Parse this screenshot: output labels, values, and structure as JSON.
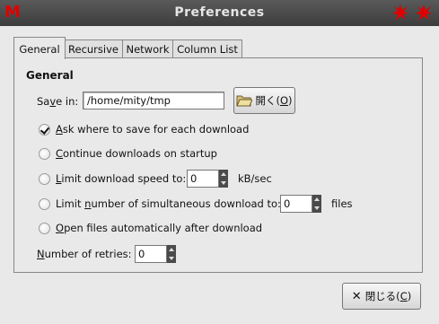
{
  "window": {
    "title": "Preferences"
  },
  "tabs": [
    {
      "label": "General"
    },
    {
      "label": "Recursive"
    },
    {
      "label": "Network"
    },
    {
      "label": "Column List"
    }
  ],
  "general": {
    "section_title": "General",
    "save_in": {
      "label_pre": "Sa",
      "label_accel": "v",
      "label_post": "e in:",
      "value": "/home/mity/tmp"
    },
    "open_button": {
      "label_pre": "開く(",
      "label_accel": "O",
      "label_post": ")"
    },
    "options": [
      {
        "accel": "A",
        "rest": "sk where to save for each download",
        "checked": true
      },
      {
        "accel": "C",
        "rest": "ontinue downloads on startup",
        "checked": false
      },
      {
        "accel": "L",
        "rest": "imit download speed to:",
        "checked": false,
        "value": "0",
        "unit": "kB/sec"
      },
      {
        "pre": "Limit ",
        "accel": "n",
        "rest": "umber of simultaneous download to:",
        "checked": false,
        "value": "0",
        "unit": "files"
      },
      {
        "accel": "O",
        "rest": "pen files automatically after download",
        "checked": false
      }
    ],
    "retries": {
      "pre": "",
      "accel": "N",
      "rest": "umber of retries:",
      "value": "0"
    }
  },
  "close_button": {
    "label_pre": "閉じる(",
    "label_accel": "C",
    "label_post": ")"
  },
  "icons": {
    "app": "M",
    "close_glyph": "✕"
  },
  "colors": {
    "app_icon": "#e00000",
    "titlebar": "#4a4a4a"
  }
}
